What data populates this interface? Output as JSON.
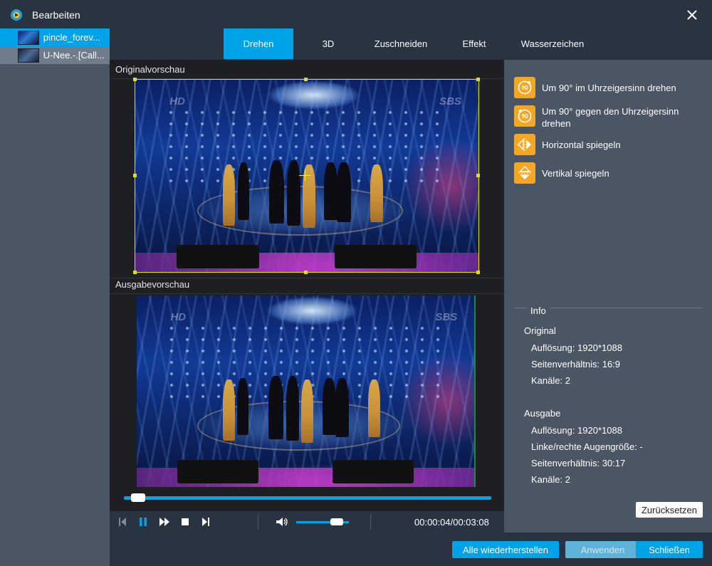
{
  "window": {
    "title": "Bearbeiten"
  },
  "files": [
    {
      "name": "pincle_forev...",
      "active": true
    },
    {
      "name": "U-Nee.-.[Call...",
      "active": false
    }
  ],
  "tabs": [
    "Drehen",
    "3D",
    "Zuschneiden",
    "Effekt",
    "Wasserzeichen"
  ],
  "active_tab": "Drehen",
  "preview": {
    "original_label": "Originalvorschau",
    "output_label": "Ausgabevorschau",
    "watermark_left": "HD",
    "watermark_right": "SBS",
    "time": "00:00:04/00:03:08",
    "playback_progress": 0.02,
    "volume": 0.85
  },
  "actions": [
    {
      "icon": "rotate-clockwise-icon",
      "badge": "90",
      "label": "Um 90° im Uhrzeigersinn drehen"
    },
    {
      "icon": "rotate-counterclockwise-icon",
      "badge": "90",
      "label": "Um 90° gegen den Uhrzeigersinn drehen"
    },
    {
      "icon": "flip-horizontal-icon",
      "label": "Horizontal spiegeln"
    },
    {
      "icon": "flip-vertical-icon",
      "label": "Vertikal spiegeln"
    }
  ],
  "info": {
    "title": "Info",
    "original_heading": "Original",
    "original_lines": [
      "Auflösung: 1920*1088",
      "Seitenverhältnis: 16:9",
      "Kanäle: 2"
    ],
    "output_heading": "Ausgabe",
    "output_lines": [
      "Auflösung: 1920*1088",
      "Linke/rechte Augengröße: -",
      "Seitenverhältnis: 30:17",
      "Kanäle: 2"
    ]
  },
  "buttons": {
    "reset": "Zurücksetzen",
    "restore_all": "Alle wiederherstellen",
    "apply": "Anwenden",
    "close": "Schließen"
  },
  "colors": {
    "accent": "#00a2e8",
    "action": "#f5a623",
    "panel": "#4a5664",
    "dark": "#2a3440"
  }
}
